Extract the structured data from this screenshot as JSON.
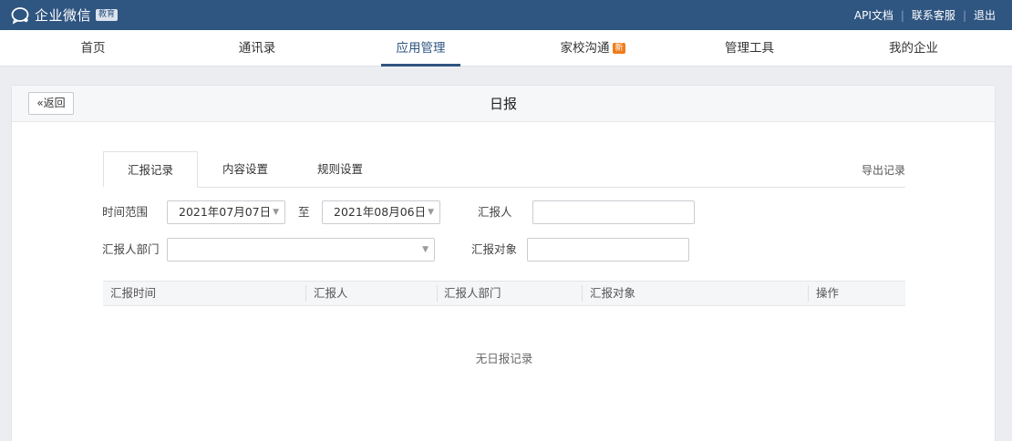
{
  "topbar": {
    "logo_text": "企业微信",
    "edu_badge": "教育",
    "links": [
      "API文档",
      "联系客服",
      "退出"
    ]
  },
  "nav": {
    "items": [
      "首页",
      "通讯录",
      "应用管理",
      "家校沟通",
      "管理工具",
      "我的企业"
    ],
    "active": "应用管理",
    "new_badge": "新"
  },
  "page": {
    "back_label": "返回",
    "title": "日报"
  },
  "tabs": {
    "items": [
      "汇报记录",
      "内容设置",
      "规则设置"
    ],
    "active": "汇报记录",
    "export_label": "导出记录"
  },
  "filters": {
    "time_range_label": "时间范围",
    "start_date": "2021年07月07日",
    "to_label": "至",
    "end_date": "2021年08月06日",
    "reporter_label": "汇报人",
    "reporter_value": "",
    "department_label": "汇报人部门",
    "department_value": "",
    "target_label": "汇报对象",
    "target_value": ""
  },
  "table": {
    "columns": [
      "汇报时间",
      "汇报人",
      "汇报人部门",
      "汇报对象",
      "操作"
    ],
    "rows": [],
    "empty_text": "无日报记录"
  },
  "colors": {
    "topbar_bg": "#2f5581",
    "accent": "#2f5581",
    "new_badge": "#f07c1a"
  }
}
